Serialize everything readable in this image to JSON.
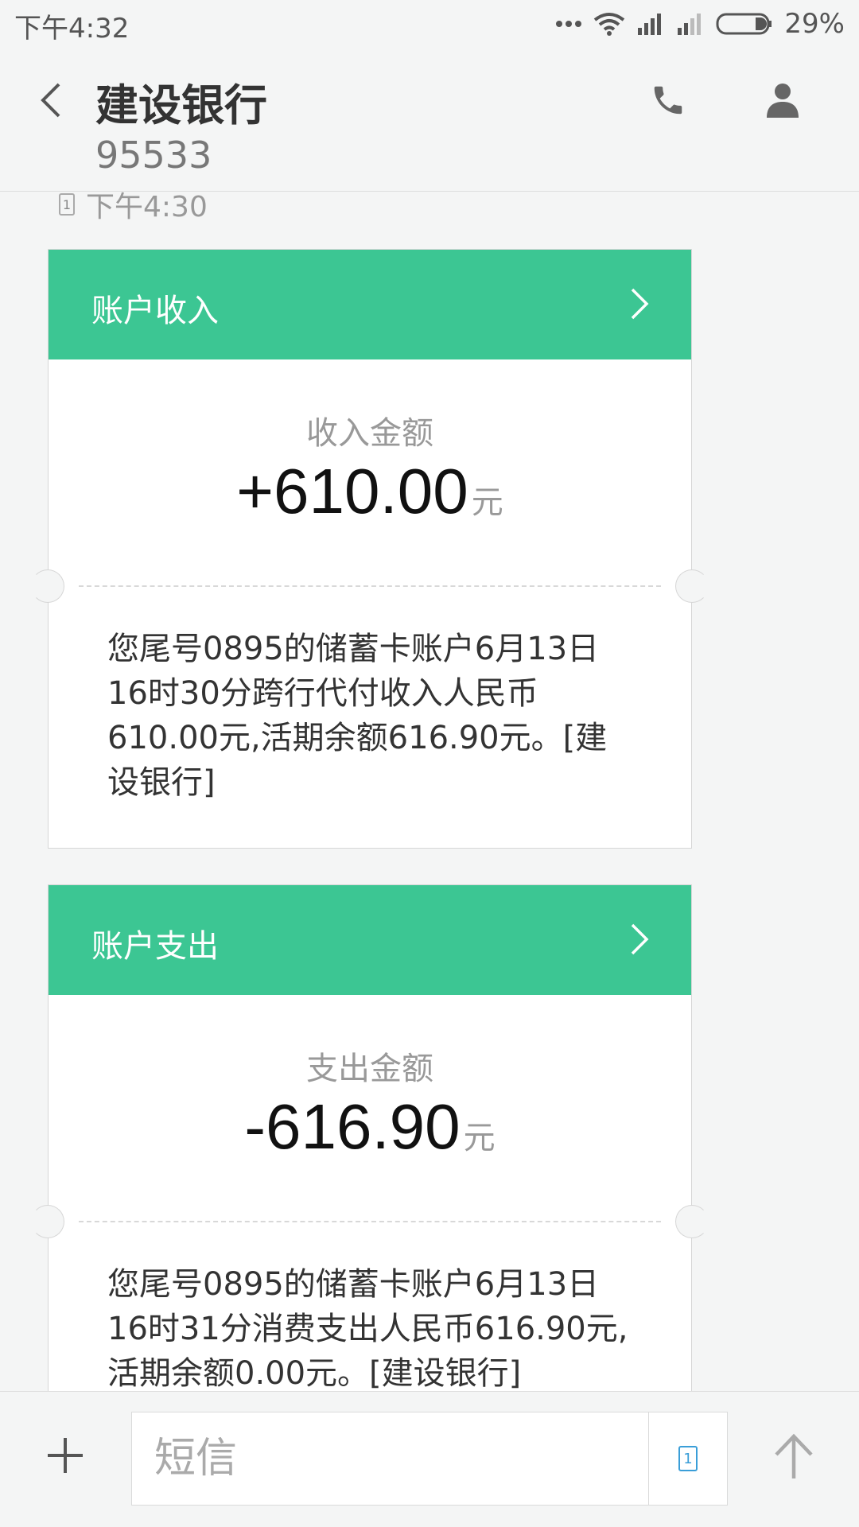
{
  "status_bar": {
    "time": "下午4:32",
    "battery": "29%",
    "icons": [
      "more-dots-icon",
      "wifi-icon",
      "signal-icon",
      "signal-weak-icon",
      "battery-icon"
    ]
  },
  "header": {
    "title": "建设银行",
    "subtitle": "95533",
    "icons": [
      "back-arrow-icon",
      "phone-icon",
      "contact-icon"
    ]
  },
  "messages": {
    "time": "下午4:30",
    "sim_slot": "1",
    "cards": [
      {
        "header": "账户收入",
        "amount_label": "收入金额",
        "amount": "+610.00",
        "unit": "元",
        "body": "您尾号0895的储蓄卡账户6月13日16时30分跨行代付收入人民币610.00元,活期余额616.90元。[建设银行]"
      },
      {
        "header": "账户支出",
        "amount_label": "支出金额",
        "amount": "-616.90",
        "unit": "元",
        "body": "您尾号0895的储蓄卡账户6月13日16时31分消费支出人民币616.90元,活期余额0.00元。[建设银行]"
      }
    ]
  },
  "input_bar": {
    "placeholder": "短信",
    "sim_slot": "1",
    "icons": [
      "plus-icon",
      "sim-card-icon",
      "send-arrow-icon"
    ]
  },
  "colors": {
    "accent_green": "#3cc693",
    "background": "#f4f5f5",
    "sim_blue": "#3a9ed8"
  }
}
